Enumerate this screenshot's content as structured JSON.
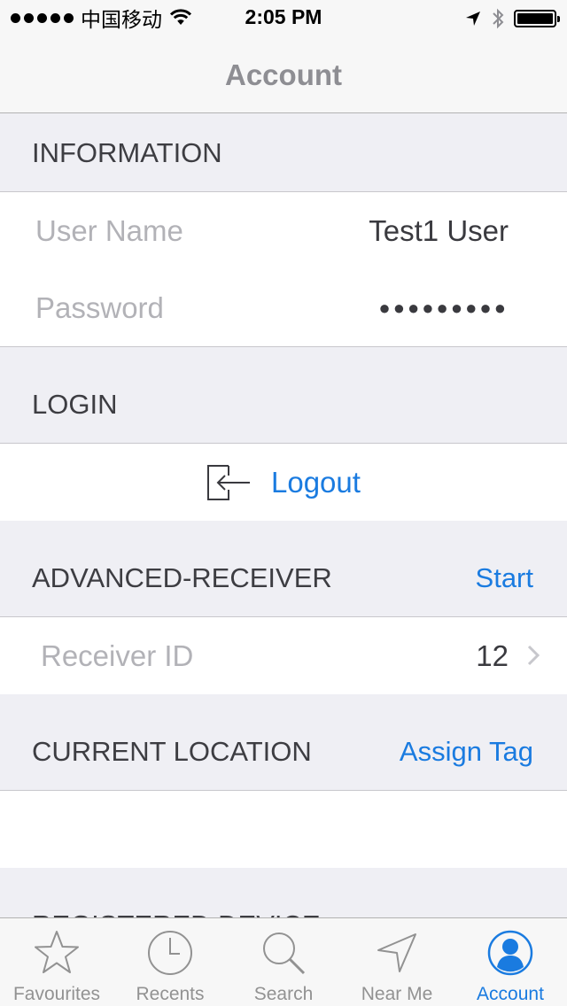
{
  "status_bar": {
    "carrier": "中国移动",
    "time": "2:05 PM"
  },
  "nav": {
    "title": "Account"
  },
  "information": {
    "header": "INFORMATION",
    "user_name_label": "User Name",
    "user_name_value": "Test1 User",
    "password_label": "Password",
    "password_value": "●●●●●●●●●"
  },
  "login": {
    "header": "LOGIN",
    "logout_label": "Logout"
  },
  "advanced_receiver": {
    "header": "ADVANCED-RECEIVER",
    "action": "Start",
    "receiver_id_label": "Receiver ID",
    "receiver_id_value": "12"
  },
  "current_location": {
    "header": "CURRENT LOCATION",
    "action": "Assign Tag"
  },
  "registered_device": {
    "header": "REGISTERED DEVICE"
  },
  "tabs": [
    {
      "label": "Favourites",
      "icon": "star-icon"
    },
    {
      "label": "Recents",
      "icon": "clock-icon"
    },
    {
      "label": "Search",
      "icon": "search-icon"
    },
    {
      "label": "Near Me",
      "icon": "location-arrow-icon"
    },
    {
      "label": "Account",
      "icon": "account-icon",
      "active": true
    }
  ],
  "colors": {
    "accent": "#1a7be0",
    "inactive_tab": "#929292",
    "section_bg": "#efeff4"
  }
}
